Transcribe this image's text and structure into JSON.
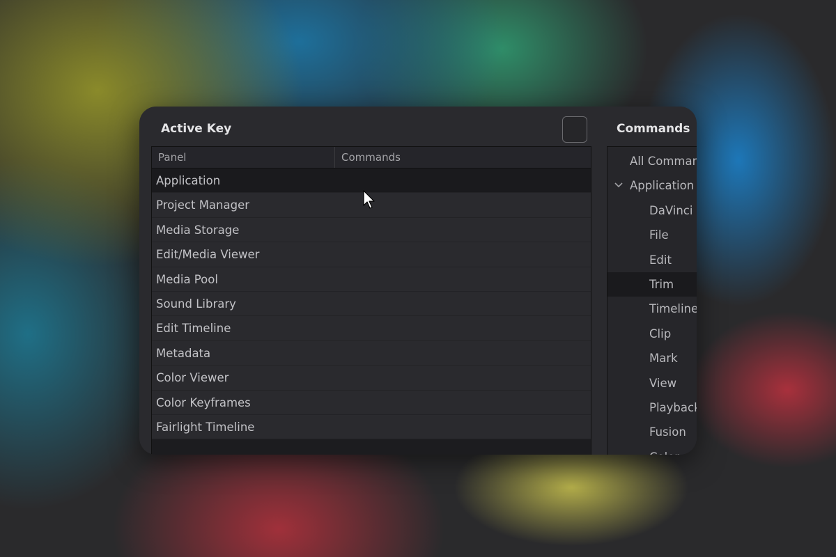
{
  "active_key": {
    "title": "Active Key",
    "columns": [
      "Panel",
      "Commands"
    ],
    "rows": [
      {
        "panel": "Application",
        "commands": "",
        "selected": true
      },
      {
        "panel": "Project Manager",
        "commands": ""
      },
      {
        "panel": "Media Storage",
        "commands": ""
      },
      {
        "panel": "Edit/Media Viewer",
        "commands": ""
      },
      {
        "panel": "Media Pool",
        "commands": ""
      },
      {
        "panel": "Sound Library",
        "commands": ""
      },
      {
        "panel": "Edit Timeline",
        "commands": ""
      },
      {
        "panel": "Metadata",
        "commands": ""
      },
      {
        "panel": "Color Viewer",
        "commands": ""
      },
      {
        "panel": "Color Keyframes",
        "commands": ""
      },
      {
        "panel": "Fairlight Timeline",
        "commands": ""
      }
    ]
  },
  "commands_panel": {
    "title": "Commands",
    "items": [
      {
        "label": "All Comman",
        "level": 0
      },
      {
        "label": "Application",
        "level": 1,
        "expanded": true,
        "icon": "chevron-down-icon"
      },
      {
        "label": "DaVinci R",
        "level": 2
      },
      {
        "label": "File",
        "level": 2
      },
      {
        "label": "Edit",
        "level": 2
      },
      {
        "label": "Trim",
        "level": 2,
        "selected": true
      },
      {
        "label": "Timeline",
        "level": 2
      },
      {
        "label": "Clip",
        "level": 2
      },
      {
        "label": "Mark",
        "level": 2
      },
      {
        "label": "View",
        "level": 2
      },
      {
        "label": "Playback",
        "level": 2
      },
      {
        "label": "Fusion",
        "level": 2
      },
      {
        "label": "Color",
        "level": 2
      }
    ]
  },
  "colors": {
    "window_bg": "#2a2a2e",
    "selected_row_bg": "#1a1a1d",
    "text": "#c2c2c6"
  },
  "icons": {
    "cursor": "mouse-pointer-icon",
    "expand": "chevron-down-icon"
  }
}
